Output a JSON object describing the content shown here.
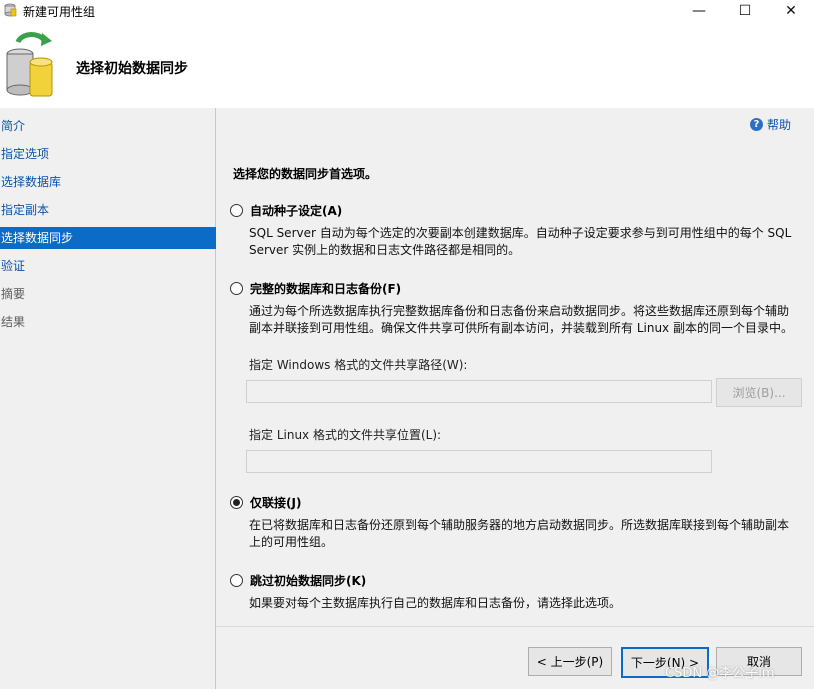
{
  "window": {
    "title": "新建可用性组",
    "minimize": "—",
    "maximize": "☐",
    "close": "✕"
  },
  "header": {
    "title": "选择初始数据同步",
    "icon": "database-sync-icon"
  },
  "sidebar": {
    "items": [
      {
        "label": "简介",
        "state": "link"
      },
      {
        "label": "指定选项",
        "state": "link"
      },
      {
        "label": "选择数据库",
        "state": "link"
      },
      {
        "label": "指定副本",
        "state": "link"
      },
      {
        "label": "选择数据同步",
        "state": "active"
      },
      {
        "label": "验证",
        "state": "link"
      },
      {
        "label": "摘要",
        "state": "disabled"
      },
      {
        "label": "结果",
        "state": "disabled"
      }
    ]
  },
  "help": {
    "label": "帮助",
    "icon": "help-icon"
  },
  "main": {
    "section_title": "选择您的数据同步首选项。",
    "options": [
      {
        "label": "自动种子设定(A)",
        "checked": false,
        "description_lines": [
          "SQL Server 自动为每个选定的次要副本创建数据库。自动种子设定要求参与到可用性组中的每个 SQL",
          "Server 实例上的数据和日志文件路径都是相同的。"
        ]
      },
      {
        "label": "完整的数据库和日志备份(F)",
        "checked": false,
        "description_lines": [
          "通过为每个所选数据库执行完整数据库备份和日志备份来启动数据同步。将这些数据库还原到每个辅助",
          "副本并联接到可用性组。确保文件共享可供所有副本访问，并装载到所有 Linux 副本的同一个目录中。"
        ]
      },
      {
        "label": "仅联接(J)",
        "checked": true,
        "description_lines": [
          "在已将数据库和日志备份还原到每个辅助服务器的地方启动数据同步。所选数据库联接到每个辅助副本",
          "上的可用性组。"
        ]
      },
      {
        "label": "跳过初始数据同步(K)",
        "checked": false,
        "description_lines": [
          "如果要对每个主数据库执行自己的数据库和日志备份，请选择此选项。"
        ]
      }
    ],
    "windows_path_label": "指定 Windows 格式的文件共享路径(W):",
    "windows_path_value": "",
    "browse_label": "浏览(B)...",
    "linux_path_label": "指定 Linux 格式的文件共享位置(L):",
    "linux_path_value": ""
  },
  "footer": {
    "prev_label": "< 上一步(P)",
    "next_label": "下一步(N) >",
    "cancel_label": "取消"
  },
  "watermark": "CSDN @李公子lm",
  "colors": {
    "accent": "#0b6cc8",
    "link": "#0b52a6",
    "panel_bg": "#f0f0f0"
  }
}
